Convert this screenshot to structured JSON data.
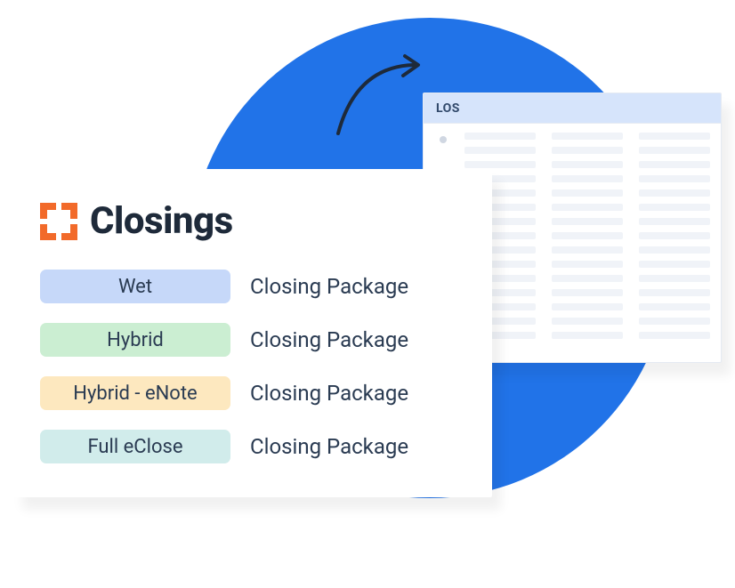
{
  "los": {
    "title": "LOS"
  },
  "closings": {
    "title": "Closings",
    "items": [
      {
        "tag": "Wet",
        "label": "Closing Package",
        "bg": "#c6d8f9"
      },
      {
        "tag": "Hybrid",
        "label": "Closing Package",
        "bg": "#cbeed2"
      },
      {
        "tag": "Hybrid - eNote",
        "label": "Closing Package",
        "bg": "#fde8bf"
      },
      {
        "tag": "Full eClose",
        "label": "Closing Package",
        "bg": "#d1eceb"
      }
    ]
  },
  "colors": {
    "accent": "#2173e8",
    "logo": "#f26a2a"
  }
}
